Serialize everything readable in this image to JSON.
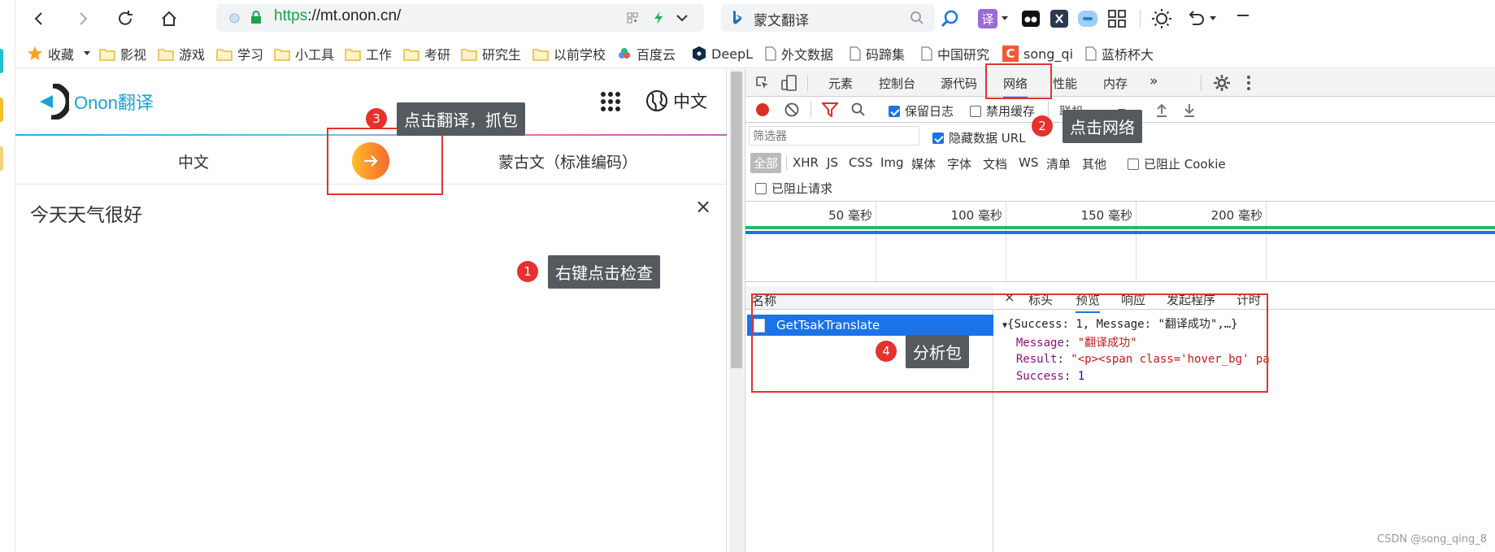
{
  "browser": {
    "url_scheme": "https",
    "url_rest": "://mt.onon.cn/",
    "search_text": "蒙文翻译",
    "translate_label": "译"
  },
  "bookmarks": [
    {
      "label": "收藏",
      "icon": "star-icon"
    },
    {
      "label": "影视",
      "icon": "folder-icon"
    },
    {
      "label": "游戏",
      "icon": "folder-icon"
    },
    {
      "label": "学习",
      "icon": "folder-icon"
    },
    {
      "label": "小工具",
      "icon": "folder-icon"
    },
    {
      "label": "工作",
      "icon": "folder-icon"
    },
    {
      "label": "考研",
      "icon": "folder-icon"
    },
    {
      "label": "研究生",
      "icon": "folder-icon"
    },
    {
      "label": "以前学校",
      "icon": "folder-icon"
    },
    {
      "label": "百度云",
      "icon": "cloud-icon"
    },
    {
      "label": "DeepL",
      "icon": "deepl-icon"
    },
    {
      "label": "外文数据",
      "icon": "page-icon"
    },
    {
      "label": "码蹄集",
      "icon": "page-icon"
    },
    {
      "label": "中国研究",
      "icon": "page-icon"
    },
    {
      "label": "song_qi",
      "icon": "csdn-icon"
    },
    {
      "label": "蓝桥杯大",
      "icon": "page-icon"
    }
  ],
  "page": {
    "brand": "Onon翻译",
    "ui_language": "中文",
    "source_language": "中文",
    "target_language": "蒙古文（标准编码）",
    "input_text": "今天天气很好",
    "close_symbol": "×"
  },
  "devtools": {
    "tabs": [
      "元素",
      "控制台",
      "源代码",
      "网络",
      "性能",
      "内存"
    ],
    "active_tab": "网络",
    "more": "»",
    "preserve_log": "保留日志",
    "disable_cache": "禁用缓存",
    "throttle": "联机",
    "filter_placeholder": "筛选器",
    "hide_data_url": "隐藏数据 URL",
    "types": [
      "全部",
      "XHR",
      "JS",
      "CSS",
      "Img",
      "媒体",
      "字体",
      "文档",
      "WS",
      "清单",
      "其他"
    ],
    "blocked_cookies": "已阻止 Cookie",
    "blocked_requests": "已阻止请求",
    "ticks": [
      "50 毫秒",
      "100 毫秒",
      "150 毫秒",
      "200 毫秒"
    ],
    "name_header": "名称",
    "request_name": "GetTsakTranslate",
    "detail_close": "×",
    "detail_tabs": [
      "标头",
      "预览",
      "响应",
      "发起程序",
      "计时"
    ],
    "active_detail_tab": "预览",
    "json_summary": "{Success: 1, Message: \"翻译成功\",…}",
    "json_message_key": "Message",
    "json_message_val": "\"翻译成功\"",
    "json_result_key": "Result",
    "json_result_val": "\"<p><span class='hover_bg' pa",
    "json_success_key": "Success",
    "json_success_val": "1"
  },
  "annotations": [
    {
      "num": "1",
      "text": "右键点击检查"
    },
    {
      "num": "2",
      "text": "点击网络"
    },
    {
      "num": "3",
      "text": "点击翻译，抓包"
    },
    {
      "num": "4",
      "text": "分析包"
    }
  ],
  "watermark": "CSDN @song_qing_8"
}
